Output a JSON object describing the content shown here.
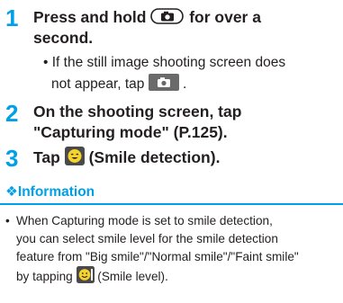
{
  "steps": [
    {
      "number": "1",
      "line1_before": "Press and hold",
      "line1_after": "for over a",
      "line2": "second.",
      "note": {
        "line1": "If the still image shooting screen does",
        "line2": "not appear, tap"
      }
    },
    {
      "number": "2",
      "line1": "On the shooting screen, tap",
      "line2": "\"Capturing mode\" (P.125)."
    },
    {
      "number": "3",
      "before": "Tap",
      "after": "(Smile detection)."
    }
  ],
  "info": {
    "heading": "Information",
    "lines": [
      "When Capturing mode is set to smile detection,",
      "you can select smile level for the smile detection",
      "feature from \"Big smile\"/\"Normal smile\"/\"Faint smile\""
    ],
    "last_before": "by tapping",
    "last_after": "(Smile level)."
  },
  "icons": {
    "camera_key": "camera-key-icon",
    "camera_button": "camera-button-icon",
    "smile": "smile-detection-icon",
    "smile_level": "smile-level-icon"
  },
  "colors": {
    "accent": "#00a0e9",
    "text": "#231f20"
  }
}
